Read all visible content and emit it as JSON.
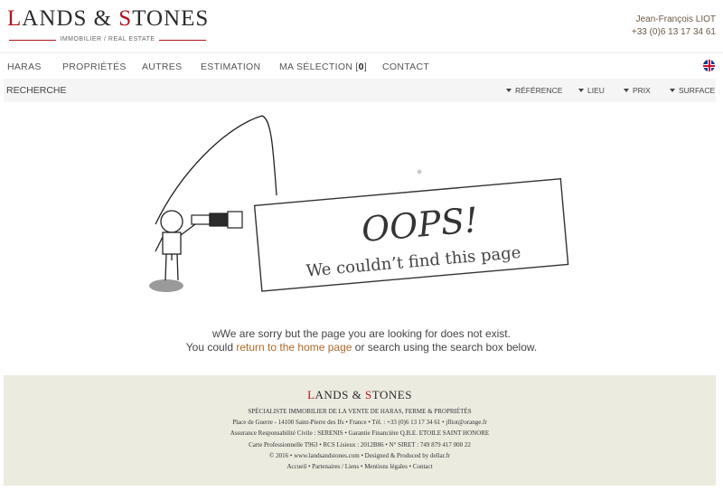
{
  "brand": {
    "first_letter": "L",
    "name_part1": "ANDS & ",
    "second_letter": "S",
    "name_part2": "TONES",
    "tagline": "IMMOBILIER / REAL ESTATE"
  },
  "agent": {
    "name": "Jean-François LIOT",
    "phone": "+33 (0)6 13 17 34 61"
  },
  "nav": {
    "items": [
      "HARAS",
      "PROPRIÉTÉS",
      "AUTRES",
      "ESTIMATION"
    ],
    "selection_label": "MA SÉLECTION [",
    "selection_count": "0",
    "selection_close": "]",
    "contact": "CONTACT",
    "language_flag": "uk-flag-icon"
  },
  "search": {
    "label": "RECHERCHE",
    "filters": [
      "RÉFÉRENCE",
      "LIEU",
      "PRIX",
      "SURFACE"
    ]
  },
  "error": {
    "title": "OOPS!",
    "subtitle": "We couldn’t find this page",
    "line1": "wWe are sorry but the page you are looking for does not exist.",
    "line2_before": "You could ",
    "home_link": "return to the home page",
    "line2_after": " or search using the search box below."
  },
  "footer": {
    "first_letter": "L",
    "name_part1": "ANDS & ",
    "second_letter": "S",
    "name_part2": "TONES",
    "lines": [
      "SPÉCIALISTE IMMOBILIER DE LA VENTE DE HARAS, FERME & PROPRIÉTÉS",
      "Place de Guerre - 14100 Saint-Pierre des Ifs • France • Tél. : +33 (0)6 13 17 34 61 • jfliot@orange.fr",
      "Assurance Responsabilité Civile : SERENIS • Garantie Financière Q.B.E. ETOILE SAINT HONORE",
      "Carte Professionnelle T963 • RCS Lisieux : 2012B86 • N° SIRET : 749 879 417 000 22",
      "© 2016 • www.landsandstones.com • Designed & Produced by dellar.fr",
      "Accueil • Partenaires / Liens • Mentions légales • Contact"
    ]
  },
  "colors": {
    "brand_red": "#b0151e",
    "link_orange": "#b2692a",
    "footer_bg": "#ecebe0"
  }
}
